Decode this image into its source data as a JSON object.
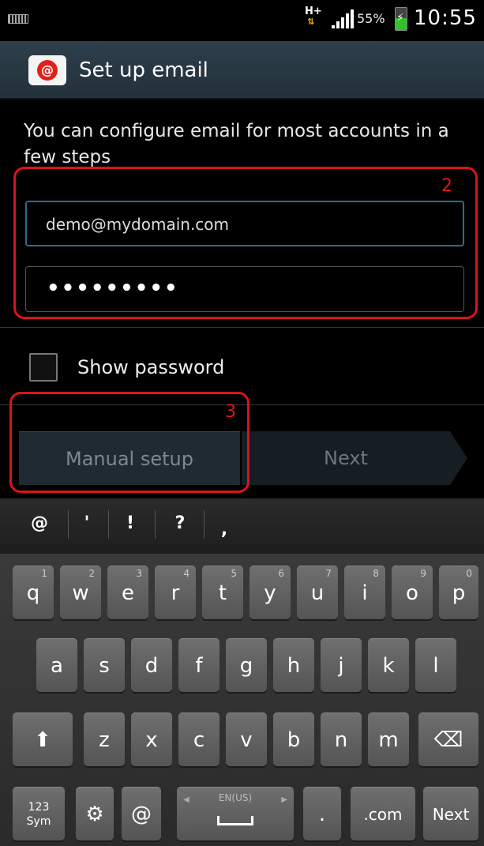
{
  "status_bar": {
    "network_type": "H+",
    "network_arrows": "⇅",
    "battery_level": 0.55,
    "battery_percent": "55%",
    "battery_bolt": "⚡",
    "time": "10:55",
    "icons": [
      "keyboard-indicator-icon",
      "signal-icon",
      "battery-charging-icon"
    ]
  },
  "app_bar": {
    "icon_glyph": "@",
    "title": "Set up email"
  },
  "form": {
    "intro": "You can configure email for most accounts in a few steps",
    "email_value": "demo@mydomain.com",
    "password_mask": "•••••••••",
    "show_password_label": "Show password",
    "show_password_checked": false
  },
  "annotations": {
    "label_2": "2",
    "label_3": "3",
    "color": "#d8141c"
  },
  "buttons": {
    "manual_setup": "Manual setup",
    "next": "Next"
  },
  "keyboard": {
    "symbols": [
      "@",
      "'",
      "!",
      "?",
      ","
    ],
    "row1": [
      {
        "key": "q",
        "hint": "1"
      },
      {
        "key": "w",
        "hint": "2"
      },
      {
        "key": "e",
        "hint": "3"
      },
      {
        "key": "r",
        "hint": "4"
      },
      {
        "key": "t",
        "hint": "5"
      },
      {
        "key": "y",
        "hint": "6"
      },
      {
        "key": "u",
        "hint": "7"
      },
      {
        "key": "i",
        "hint": "8"
      },
      {
        "key": "o",
        "hint": "9"
      },
      {
        "key": "p",
        "hint": "0"
      }
    ],
    "row2": [
      "a",
      "s",
      "d",
      "f",
      "g",
      "h",
      "j",
      "k",
      "l"
    ],
    "row3": [
      "z",
      "x",
      "c",
      "v",
      "b",
      "n",
      "m"
    ],
    "shift_glyph": "⬆",
    "backspace_glyph": "⌫",
    "sym_key_line1": "123",
    "sym_key_line2": "Sym",
    "settings_glyph": "⚙",
    "at_key": "@",
    "language": "EN(US)",
    "left_arrow": "◀",
    "right_arrow": "▶",
    "period_key": ".",
    "dotcom_key": ".com",
    "next_key": "Next",
    "colors": {
      "key": "#5f5f5f",
      "background": "#2a2a2a"
    }
  }
}
